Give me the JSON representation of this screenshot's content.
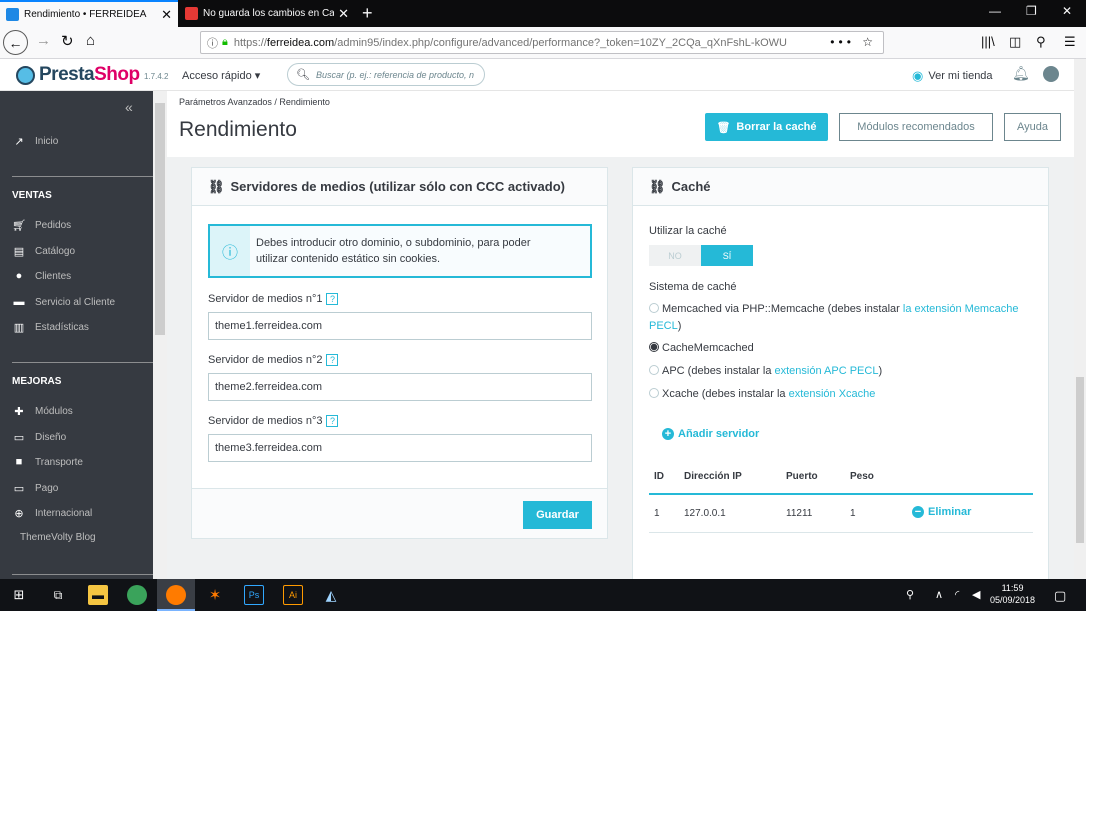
{
  "browser": {
    "tabs": [
      {
        "title": "Rendimiento • FERREIDEA",
        "active": true
      },
      {
        "title": "No guarda los cambios en Cate",
        "active": false
      }
    ],
    "new_tab": "+",
    "url_prefix": "https://",
    "url_domain": "ferreidea.com",
    "url_path": "/admin95/index.php/configure/advanced/performance?_token=10ZY_2CQa_qXnFshL-kOWU",
    "url_actions": "••• ☆"
  },
  "ps_header": {
    "logo_text_1": "Presta",
    "logo_text_2": "Shop",
    "version": "1.7.4.2",
    "quick_access": "Acceso rápido ▾",
    "search_placeholder": "Buscar (p. ej.: referencia de producto, n",
    "view_shop": "Ver mi tienda"
  },
  "sidebar": {
    "collapse": "«",
    "home": "Inicio",
    "sections": [
      {
        "title": "VENTAS",
        "items": [
          {
            "label": "Pedidos",
            "icon": "cart-icon"
          },
          {
            "label": "Catálogo",
            "icon": "store-icon"
          },
          {
            "label": "Clientes",
            "icon": "user-icon"
          },
          {
            "label": "Servicio al Cliente",
            "icon": "chat-icon"
          },
          {
            "label": "Estadísticas",
            "icon": "stats-icon"
          }
        ]
      },
      {
        "title": "MEJORAS",
        "items": [
          {
            "label": "Módulos",
            "icon": "puzzle-icon"
          },
          {
            "label": "Diseño",
            "icon": "monitor-icon"
          },
          {
            "label": "Transporte",
            "icon": "truck-icon"
          },
          {
            "label": "Pago",
            "icon": "credit-card-icon"
          },
          {
            "label": "Internacional",
            "icon": "globe-icon"
          },
          {
            "label": "ThemeVolty Blog",
            "icon": ""
          }
        ]
      }
    ]
  },
  "page": {
    "breadcrumb": "Parámetros Avanzados  /  Rendimiento",
    "title": "Rendimiento",
    "btn_clear_cache": "Borrar la caché",
    "btn_modules": "Módulos recomendados",
    "btn_help": "Ayuda"
  },
  "media_panel": {
    "title": "Servidores de medios (utilizar sólo con CCC activado)",
    "alert": [
      "Debes introducir otro dominio, o subdominio, para poder",
      "utilizar contenido estático sin cookies."
    ],
    "servers": [
      {
        "label": "Servidor de medios n°1",
        "value": "theme1.ferreidea.com"
      },
      {
        "label": "Servidor de medios n°2",
        "value": "theme2.ferreidea.com"
      },
      {
        "label": "Servidor de medios n°3",
        "value": "theme3.ferreidea.com"
      }
    ],
    "help": "?",
    "save": "Guardar"
  },
  "cache_panel": {
    "title": "Caché",
    "use_cache_label": "Utilizar la caché",
    "toggle_no": "NO",
    "toggle_yes": "SÍ",
    "toggle_value": "SÍ",
    "system_label": "Sistema de caché",
    "options": [
      {
        "text": "Memcached via PHP::Memcache (debes instalar ",
        "link": "la extensión Memcache PECL",
        "tail": ")",
        "selected": false
      },
      {
        "text": "CacheMemcached",
        "link": "",
        "tail": "",
        "selected": true
      },
      {
        "text": "APC (debes instalar la ",
        "link": "extensión APC PECL",
        "tail": ")",
        "selected": false
      },
      {
        "text": "Xcache (debes instalar la ",
        "link": "extensión Xcache",
        "tail": "",
        "selected": false
      }
    ],
    "add_server": "Añadir servidor",
    "table": {
      "headers": [
        "ID",
        "Dirección IP",
        "Puerto",
        "Peso"
      ],
      "rows": [
        {
          "id": "1",
          "ip": "127.0.0.1",
          "port": "11211",
          "weight": "1"
        }
      ],
      "delete": "Eliminar"
    }
  },
  "taskbar": {
    "time": "11:59",
    "date": "05/09/2018"
  }
}
